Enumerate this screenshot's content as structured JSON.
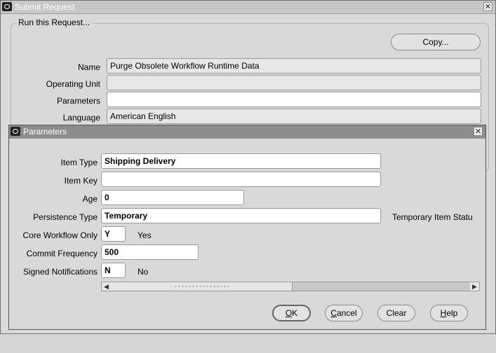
{
  "submit_window": {
    "title": "Submit Request",
    "group_label": "Run this Request...",
    "copy_button": "Copy...",
    "fields": {
      "name_label": "Name",
      "name_value": "Purge Obsolete Workflow Runtime Data",
      "operating_unit_label": "Operating Unit",
      "operating_unit_value": "",
      "parameters_label": "Parameters",
      "parameters_value": "",
      "language_label": "Language",
      "language_value": "American English"
    }
  },
  "parameters_window": {
    "title": "Parameters",
    "fields": {
      "item_type_label": "Item Type",
      "item_type_value": "Shipping Delivery",
      "item_key_label": "Item Key",
      "item_key_value": "",
      "age_label": "Age",
      "age_value": "0",
      "persistence_type_label": "Persistence Type",
      "persistence_type_value": "Temporary",
      "persistence_type_desc": "Temporary Item Statu",
      "core_workflow_only_label": "Core Workflow Only",
      "core_workflow_only_value": "Y",
      "core_workflow_only_desc": "Yes",
      "commit_frequency_label": "Commit Frequency",
      "commit_frequency_value": "500",
      "signed_notifications_label": "Signed Notifications",
      "signed_notifications_value": "N",
      "signed_notifications_desc": "No"
    },
    "buttons": {
      "ok_key": "O",
      "ok_rest": "K",
      "cancel_key": "C",
      "cancel_rest": "ancel",
      "clear": "Clear",
      "help_key": "H",
      "help_rest": "elp"
    },
    "scrollbar": {
      "position": 0.3
    }
  },
  "icons": {
    "window_close": "close-icon",
    "oracle_logo": "oracle-logo-icon",
    "scroll_left": "arrow-left-icon",
    "scroll_right": "arrow-right-icon"
  }
}
